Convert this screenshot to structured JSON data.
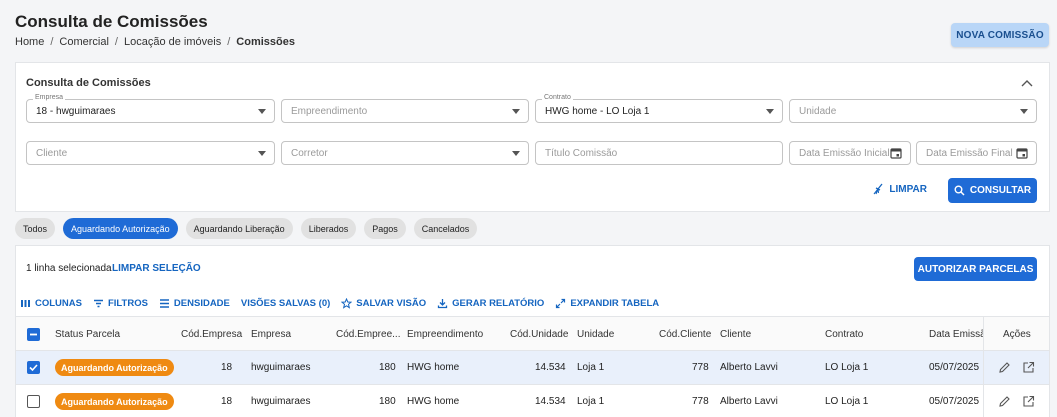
{
  "header": {
    "title": "Consulta de Comissões",
    "breadcrumb": [
      "Home",
      "Comercial",
      "Locação de imóveis",
      "Comissões"
    ],
    "new_button": "NOVA COMISSÃO"
  },
  "filters": {
    "title": "Consulta de Comissões",
    "empresa": {
      "label": "Empresa",
      "value": "18 - hwguimaraes"
    },
    "empreendimento": {
      "placeholder": "Empreendimento"
    },
    "contrato": {
      "label": "Contrato",
      "value": "HWG home - LO Loja 1"
    },
    "unidade": {
      "placeholder": "Unidade"
    },
    "cliente": {
      "placeholder": "Cliente"
    },
    "corretor": {
      "placeholder": "Corretor"
    },
    "titulo": {
      "placeholder": "Título Comissão"
    },
    "data_inicial": {
      "placeholder": "Data Emissão Inicial"
    },
    "data_final": {
      "placeholder": "Data Emissão Final"
    },
    "limpar": "LIMPAR",
    "consultar": "CONSULTAR"
  },
  "tabs": [
    "Todos",
    "Aguardando Autorização",
    "Aguardando Liberação",
    "Liberados",
    "Pagos",
    "Cancelados"
  ],
  "active_tab": 1,
  "selection": {
    "text": "1 linha selecionada",
    "clear": "LIMPAR SELEÇÃO",
    "authorize": "AUTORIZAR PARCELAS"
  },
  "toolbar": {
    "colunas": "COLUNAS",
    "filtros": "FILTROS",
    "densidade": "DENSIDADE",
    "visoes": "VISÕES SALVAS (0)",
    "salvar": "SALVAR VISÃO",
    "relatorio": "GERAR RELATÓRIO",
    "expandir": "EXPANDIR TABELA"
  },
  "table": {
    "columns": {
      "status": "Status Parcela",
      "cod_empresa": "Cód.Empresa",
      "empresa": "Empresa",
      "cod_empreendimento": "Cód.Empree...",
      "empreendimento": "Empreendimento",
      "cod_unidade": "Cód.Unidade",
      "unidade": "Unidade",
      "cod_cliente": "Cód.Cliente",
      "cliente": "Cliente",
      "contrato": "Contrato",
      "data_emissao": "Data Emissão",
      "acoes": "Ações"
    },
    "rows": [
      {
        "selected": true,
        "status": "Aguardando Autorização",
        "cod_empresa": "18",
        "empresa": "hwguimaraes",
        "cod_empreendimento": "180",
        "empreendimento": "HWG home",
        "cod_unidade": "14.534",
        "unidade": "Loja 1",
        "cod_cliente": "778",
        "cliente": "Alberto Lavvi",
        "contrato": "LO Loja 1",
        "data_emissao": "05/07/2025"
      },
      {
        "selected": false,
        "status": "Aguardando Autorização",
        "cod_empresa": "18",
        "empresa": "hwguimaraes",
        "cod_empreendimento": "180",
        "empreendimento": "HWG home",
        "cod_unidade": "14.534",
        "unidade": "Loja 1",
        "cod_cliente": "778",
        "cliente": "Alberto Lavvi",
        "contrato": "LO Loja 1",
        "data_emissao": "05/07/2025"
      }
    ]
  },
  "colors": {
    "primary": "#1f6bd6",
    "status_badge": "#ef8a12",
    "link": "#1565c0"
  }
}
